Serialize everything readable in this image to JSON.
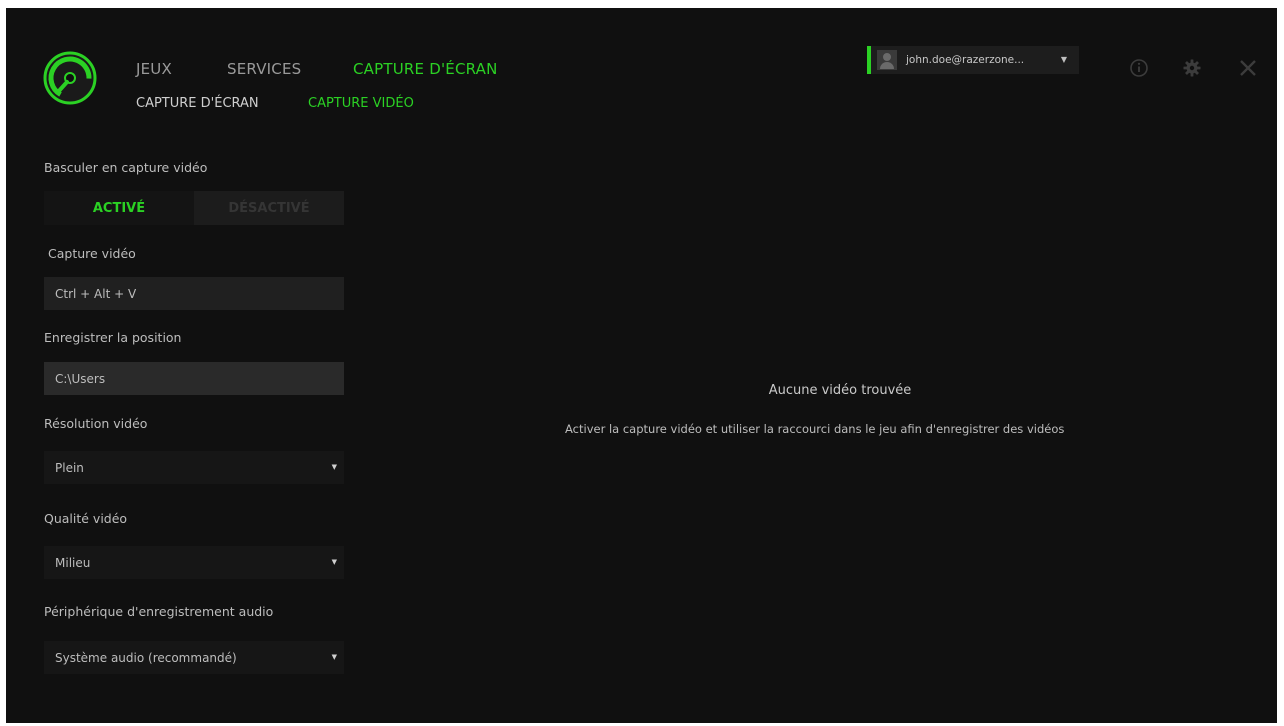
{
  "nav": {
    "tabs": [
      {
        "label": "JEUX"
      },
      {
        "label": "SERVICES"
      },
      {
        "label": "CAPTURE D'ÉCRAN"
      }
    ],
    "subtabs": [
      {
        "label": "CAPTURE D'ÉCRAN"
      },
      {
        "label": "CAPTURE VIDÉO"
      }
    ]
  },
  "user": {
    "name": "john.doe@razerzone...",
    "caret": "▼"
  },
  "icons": {
    "logo": "razer-cortex-logo-icon",
    "info": "info-icon",
    "settings": "gear-icon",
    "close": "close-icon"
  },
  "settings": {
    "toggle_label": "Basculer en capture vidéo",
    "toggle_on": "ACTIVÉ",
    "toggle_off": "DÉSACTIVÉ",
    "hotkey_label": "Capture vidéo",
    "hotkey_value": "Ctrl + Alt + V",
    "path_label": "Enregistrer la position",
    "path_value": "C:\\Users",
    "resolution_label": "Résolution vidéo",
    "resolution_value": "Plein",
    "quality_label": "Qualité vidéo",
    "quality_value": "Milieu",
    "audio_label": "Périphérique d'enregistrement audio",
    "audio_value": "Système audio (recommandé)",
    "dropdown_caret": "▼"
  },
  "empty_state": {
    "title": "Aucune vidéo trouvée",
    "subtitle": "Activer la capture vidéo et utiliser la raccourci dans le jeu afin d'enregistrer des vidéos"
  },
  "colors": {
    "accent": "#2bd124",
    "background": "#101010"
  }
}
